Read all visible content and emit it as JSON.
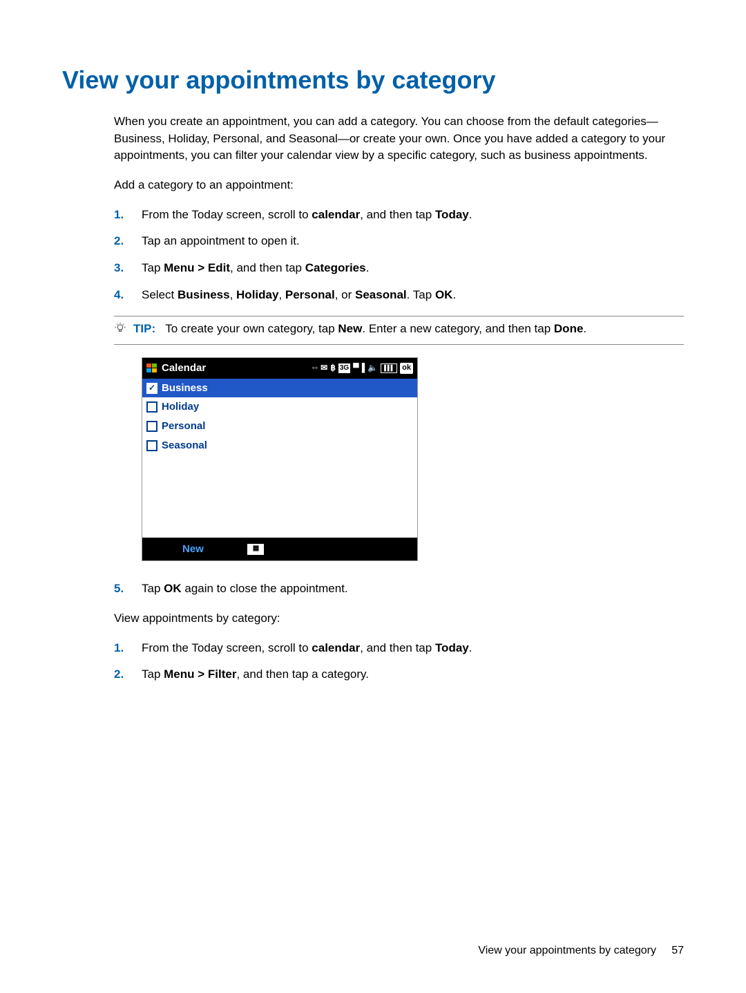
{
  "heading": "View your appointments by category",
  "intro": "When you create an appointment, you can add a category. You can choose from the default categories—Business, Holiday, Personal, and Seasonal—or create your own. Once you have added a category to your appointments, you can filter your calendar view by a specific category, such as business appointments.",
  "add_title": "Add a category to an appointment:",
  "steps_a": {
    "s1_a": "From the Today screen, scroll to ",
    "s1_b": "calendar",
    "s1_c": ", and then tap ",
    "s1_d": "Today",
    "s1_e": ".",
    "s2": "Tap an appointment to open it.",
    "s3_a": "Tap ",
    "s3_b": "Menu > Edit",
    "s3_c": ", and then tap ",
    "s3_d": "Categories",
    "s3_e": ".",
    "s4_a": "Select ",
    "s4_b": "Business",
    "s4_c": ", ",
    "s4_d": "Holiday",
    "s4_e": ", ",
    "s4_f": "Personal",
    "s4_g": ", or ",
    "s4_h": "Seasonal",
    "s4_i": ". Tap ",
    "s4_j": "OK",
    "s4_k": "."
  },
  "tip": {
    "label": "TIP:",
    "t1": "To create your own category, tap ",
    "t2": "New",
    "t3": ". Enter a new category, and then tap ",
    "t4": "Done",
    "t5": "."
  },
  "screenshot": {
    "title": "Calendar",
    "status_3g": "3G",
    "status_ok": "ok",
    "items": {
      "business": "Business",
      "holiday": "Holiday",
      "personal": "Personal",
      "seasonal": "Seasonal"
    },
    "new": "New"
  },
  "steps_a5_a": "Tap ",
  "steps_a5_b": "OK",
  "steps_a5_c": " again to close the appointment.",
  "view_title": "View appointments by category:",
  "steps_b": {
    "s1_a": "From the Today screen, scroll to ",
    "s1_b": "calendar",
    "s1_c": ", and then tap ",
    "s1_d": "Today",
    "s1_e": ".",
    "s2_a": "Tap ",
    "s2_b": "Menu > Filter",
    "s2_c": ", and then tap a category."
  },
  "footer_text": "View your appointments by category",
  "footer_page": "57"
}
